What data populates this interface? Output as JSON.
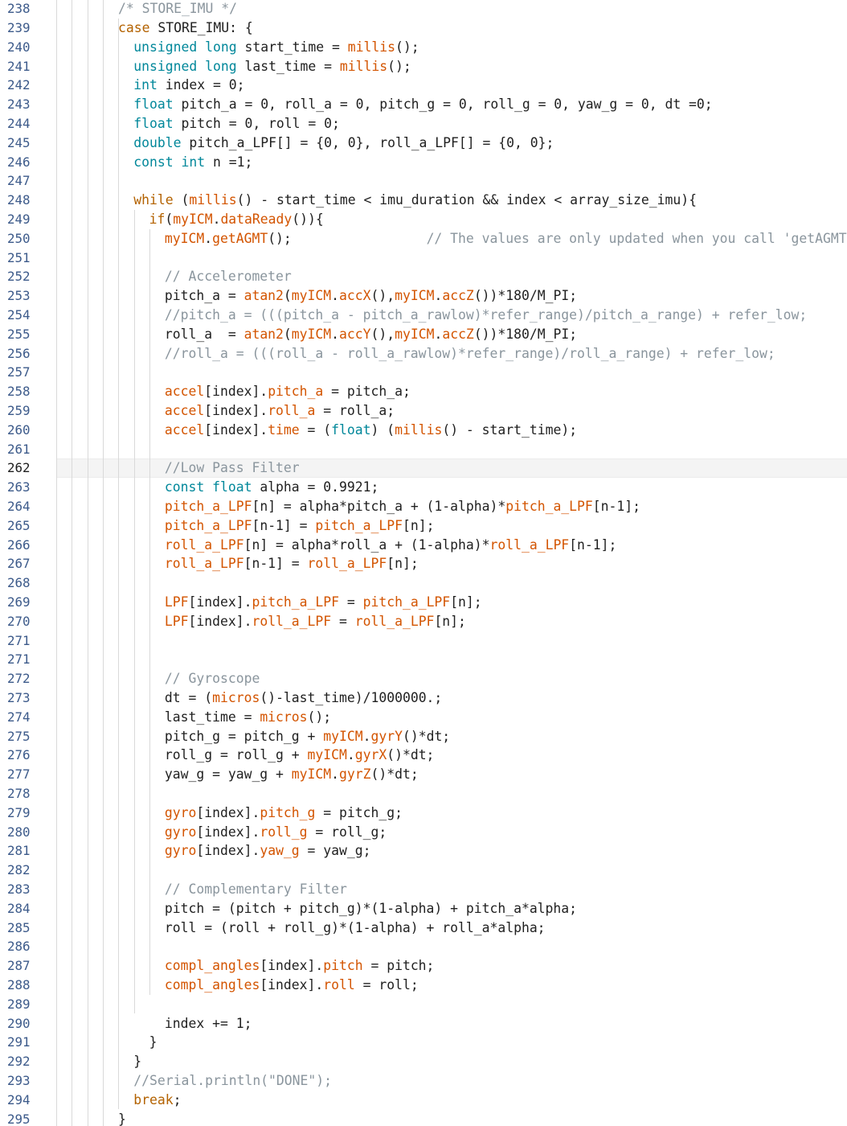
{
  "editor": {
    "current_line": "262",
    "lines": [
      {
        "n": "238",
        "i": 4,
        "t": [
          [
            "/* STORE_IMU */",
            "cm"
          ]
        ]
      },
      {
        "n": "239",
        "i": 4,
        "t": [
          [
            "case",
            "kw"
          ],
          [
            " STORE_IMU: {",
            ""
          ]
        ]
      },
      {
        "n": "240",
        "i": 5,
        "t": [
          [
            "unsigned",
            "ty"
          ],
          [
            " ",
            ""
          ],
          [
            "long",
            "ty"
          ],
          [
            " start_time = ",
            ""
          ],
          [
            "millis",
            "fn"
          ],
          [
            "();",
            ""
          ]
        ]
      },
      {
        "n": "241",
        "i": 5,
        "t": [
          [
            "unsigned",
            "ty"
          ],
          [
            " ",
            ""
          ],
          [
            "long",
            "ty"
          ],
          [
            " last_time = ",
            ""
          ],
          [
            "millis",
            "fn"
          ],
          [
            "();",
            ""
          ]
        ]
      },
      {
        "n": "242",
        "i": 5,
        "t": [
          [
            "int",
            "ty"
          ],
          [
            " index = 0;",
            ""
          ]
        ]
      },
      {
        "n": "243",
        "i": 5,
        "t": [
          [
            "float",
            "ty"
          ],
          [
            " pitch_a = 0, roll_a = 0, pitch_g = 0, roll_g = 0, yaw_g = 0, dt =0;",
            ""
          ]
        ]
      },
      {
        "n": "244",
        "i": 5,
        "t": [
          [
            "float",
            "ty"
          ],
          [
            " pitch = 0, roll = 0;",
            ""
          ]
        ]
      },
      {
        "n": "245",
        "i": 5,
        "t": [
          [
            "double",
            "ty"
          ],
          [
            " pitch_a_LPF[] = {0, 0}, roll_a_LPF[] = {0, 0};",
            ""
          ]
        ]
      },
      {
        "n": "246",
        "i": 5,
        "t": [
          [
            "const",
            "ty"
          ],
          [
            " ",
            ""
          ],
          [
            "int",
            "ty"
          ],
          [
            " n =1;",
            ""
          ]
        ]
      },
      {
        "n": "247",
        "i": 5,
        "t": []
      },
      {
        "n": "248",
        "i": 5,
        "t": [
          [
            "while",
            "kw"
          ],
          [
            " (",
            ""
          ],
          [
            "millis",
            "fn"
          ],
          [
            "() - start_time < imu_duration && index < array_size_imu){",
            ""
          ]
        ]
      },
      {
        "n": "249",
        "i": 6,
        "t": [
          [
            "if",
            "kw"
          ],
          [
            "(",
            ""
          ],
          [
            "myICM",
            "fn"
          ],
          [
            ".",
            ""
          ],
          [
            "dataReady",
            "fn"
          ],
          [
            "()){",
            ""
          ]
        ]
      },
      {
        "n": "250",
        "i": 7,
        "t": [
          [
            "myICM",
            "fn"
          ],
          [
            ".",
            ""
          ],
          [
            "getAGMT",
            "fn"
          ],
          [
            "();                 ",
            ""
          ],
          [
            "// The values are only updated when you call 'getAGMT'",
            "cm"
          ]
        ]
      },
      {
        "n": "251",
        "i": 7,
        "t": []
      },
      {
        "n": "252",
        "i": 7,
        "t": [
          [
            "// Accelerometer",
            "cm"
          ]
        ]
      },
      {
        "n": "253",
        "i": 7,
        "t": [
          [
            "pitch_a = ",
            ""
          ],
          [
            "atan2",
            "fn"
          ],
          [
            "(",
            ""
          ],
          [
            "myICM",
            "fn"
          ],
          [
            ".",
            ""
          ],
          [
            "accX",
            "fn"
          ],
          [
            "(),",
            ""
          ],
          [
            "myICM",
            "fn"
          ],
          [
            ".",
            ""
          ],
          [
            "accZ",
            "fn"
          ],
          [
            "())*180/M_PI;",
            ""
          ]
        ]
      },
      {
        "n": "254",
        "i": 7,
        "t": [
          [
            "//pitch_a = (((pitch_a - pitch_a_rawlow)*refer_range)/pitch_a_range) + refer_low;",
            "cm"
          ]
        ]
      },
      {
        "n": "255",
        "i": 7,
        "t": [
          [
            "roll_a  = ",
            ""
          ],
          [
            "atan2",
            "fn"
          ],
          [
            "(",
            ""
          ],
          [
            "myICM",
            "fn"
          ],
          [
            ".",
            ""
          ],
          [
            "accY",
            "fn"
          ],
          [
            "(),",
            ""
          ],
          [
            "myICM",
            "fn"
          ],
          [
            ".",
            ""
          ],
          [
            "accZ",
            "fn"
          ],
          [
            "())*180/M_PI;",
            ""
          ]
        ]
      },
      {
        "n": "256",
        "i": 7,
        "t": [
          [
            "//roll_a = (((roll_a - roll_a_rawlow)*refer_range)/roll_a_range) + refer_low;",
            "cm"
          ]
        ]
      },
      {
        "n": "257",
        "i": 7,
        "t": []
      },
      {
        "n": "258",
        "i": 7,
        "t": [
          [
            "accel",
            "fn"
          ],
          [
            "[index].",
            ""
          ],
          [
            "pitch_a",
            "fn"
          ],
          [
            " = pitch_a;",
            ""
          ]
        ]
      },
      {
        "n": "259",
        "i": 7,
        "t": [
          [
            "accel",
            "fn"
          ],
          [
            "[index].",
            ""
          ],
          [
            "roll_a",
            "fn"
          ],
          [
            " = roll_a;",
            ""
          ]
        ]
      },
      {
        "n": "260",
        "i": 7,
        "t": [
          [
            "accel",
            "fn"
          ],
          [
            "[index].",
            ""
          ],
          [
            "time",
            "fn"
          ],
          [
            " = (",
            ""
          ],
          [
            "float",
            "ty"
          ],
          [
            ") (",
            ""
          ],
          [
            "millis",
            "fn"
          ],
          [
            "() - start_time);",
            ""
          ]
        ]
      },
      {
        "n": "261",
        "i": 7,
        "t": []
      },
      {
        "n": "262",
        "i": 7,
        "t": [
          [
            "//Low Pass Filter",
            "cm"
          ]
        ]
      },
      {
        "n": "263",
        "i": 7,
        "t": [
          [
            "const",
            "ty"
          ],
          [
            " ",
            ""
          ],
          [
            "float",
            "ty"
          ],
          [
            " alpha = 0.9921;",
            ""
          ]
        ]
      },
      {
        "n": "264",
        "i": 7,
        "t": [
          [
            "pitch_a_LPF",
            "fn"
          ],
          [
            "[n] = alpha*pitch_a + (1-alpha)*",
            ""
          ],
          [
            "pitch_a_LPF",
            "fn"
          ],
          [
            "[n-1];",
            ""
          ]
        ]
      },
      {
        "n": "265",
        "i": 7,
        "t": [
          [
            "pitch_a_LPF",
            "fn"
          ],
          [
            "[n-1] = ",
            ""
          ],
          [
            "pitch_a_LPF",
            "fn"
          ],
          [
            "[n];",
            ""
          ]
        ]
      },
      {
        "n": "266",
        "i": 7,
        "t": [
          [
            "roll_a_LPF",
            "fn"
          ],
          [
            "[n] = alpha*roll_a + (1-alpha)*",
            ""
          ],
          [
            "roll_a_LPF",
            "fn"
          ],
          [
            "[n-1];",
            ""
          ]
        ]
      },
      {
        "n": "267",
        "i": 7,
        "t": [
          [
            "roll_a_LPF",
            "fn"
          ],
          [
            "[n-1] = ",
            ""
          ],
          [
            "roll_a_LPF",
            "fn"
          ],
          [
            "[n];",
            ""
          ]
        ]
      },
      {
        "n": "268",
        "i": 7,
        "t": []
      },
      {
        "n": "269",
        "i": 7,
        "t": [
          [
            "LPF",
            "fn"
          ],
          [
            "[index].",
            ""
          ],
          [
            "pitch_a_LPF",
            "fn"
          ],
          [
            " = ",
            ""
          ],
          [
            "pitch_a_LPF",
            "fn"
          ],
          [
            "[n];",
            ""
          ]
        ]
      },
      {
        "n": "270",
        "i": 7,
        "t": [
          [
            "LPF",
            "fn"
          ],
          [
            "[index].",
            ""
          ],
          [
            "roll_a_LPF",
            "fn"
          ],
          [
            " = ",
            ""
          ],
          [
            "roll_a_LPF",
            "fn"
          ],
          [
            "[n];",
            ""
          ]
        ]
      },
      {
        "n": "271",
        "i": 7,
        "t": []
      },
      {
        "n": "271",
        "i": 7,
        "t": []
      },
      {
        "n": "272",
        "i": 7,
        "t": [
          [
            "// Gyroscope",
            "cm"
          ]
        ]
      },
      {
        "n": "273",
        "i": 7,
        "t": [
          [
            "dt = (",
            ""
          ],
          [
            "micros",
            "fn"
          ],
          [
            "()-last_time)/1000000.;",
            ""
          ]
        ]
      },
      {
        "n": "274",
        "i": 7,
        "t": [
          [
            "last_time = ",
            ""
          ],
          [
            "micros",
            "fn"
          ],
          [
            "();",
            ""
          ]
        ]
      },
      {
        "n": "275",
        "i": 7,
        "t": [
          [
            "pitch_g = pitch_g + ",
            ""
          ],
          [
            "myICM",
            "fn"
          ],
          [
            ".",
            ""
          ],
          [
            "gyrY",
            "fn"
          ],
          [
            "()*dt;",
            ""
          ]
        ]
      },
      {
        "n": "276",
        "i": 7,
        "t": [
          [
            "roll_g = roll_g + ",
            ""
          ],
          [
            "myICM",
            "fn"
          ],
          [
            ".",
            ""
          ],
          [
            "gyrX",
            "fn"
          ],
          [
            "()*dt;",
            ""
          ]
        ]
      },
      {
        "n": "277",
        "i": 7,
        "t": [
          [
            "yaw_g = yaw_g + ",
            ""
          ],
          [
            "myICM",
            "fn"
          ],
          [
            ".",
            ""
          ],
          [
            "gyrZ",
            "fn"
          ],
          [
            "()*dt;",
            ""
          ]
        ]
      },
      {
        "n": "278",
        "i": 7,
        "t": []
      },
      {
        "n": "279",
        "i": 7,
        "t": [
          [
            "gyro",
            "fn"
          ],
          [
            "[index].",
            ""
          ],
          [
            "pitch_g",
            "fn"
          ],
          [
            " = pitch_g;",
            ""
          ]
        ]
      },
      {
        "n": "280",
        "i": 7,
        "t": [
          [
            "gyro",
            "fn"
          ],
          [
            "[index].",
            ""
          ],
          [
            "roll_g",
            "fn"
          ],
          [
            " = roll_g;",
            ""
          ]
        ]
      },
      {
        "n": "281",
        "i": 7,
        "t": [
          [
            "gyro",
            "fn"
          ],
          [
            "[index].",
            ""
          ],
          [
            "yaw_g",
            "fn"
          ],
          [
            " = yaw_g;",
            ""
          ]
        ]
      },
      {
        "n": "282",
        "i": 7,
        "t": []
      },
      {
        "n": "283",
        "i": 7,
        "t": [
          [
            "// Complementary Filter",
            "cm"
          ]
        ]
      },
      {
        "n": "284",
        "i": 7,
        "t": [
          [
            "pitch = (pitch + pitch_g)*(1-alpha) + pitch_a*alpha;",
            ""
          ]
        ]
      },
      {
        "n": "285",
        "i": 7,
        "t": [
          [
            "roll = (roll + roll_g)*(1-alpha) + roll_a*alpha;",
            ""
          ]
        ]
      },
      {
        "n": "286",
        "i": 7,
        "t": []
      },
      {
        "n": "287",
        "i": 7,
        "t": [
          [
            "compl_angles",
            "fn"
          ],
          [
            "[index].",
            ""
          ],
          [
            "pitch",
            "fn"
          ],
          [
            " = pitch;",
            ""
          ]
        ]
      },
      {
        "n": "288",
        "i": 7,
        "t": [
          [
            "compl_angles",
            "fn"
          ],
          [
            "[index].",
            ""
          ],
          [
            "roll",
            "fn"
          ],
          [
            " = roll;",
            ""
          ]
        ]
      },
      {
        "n": "289",
        "i": 7,
        "t": []
      },
      {
        "n": "290",
        "i": 7,
        "t": [
          [
            "index += 1;",
            ""
          ]
        ]
      },
      {
        "n": "291",
        "i": 6,
        "t": [
          [
            "}",
            ""
          ]
        ]
      },
      {
        "n": "292",
        "i": 5,
        "t": [
          [
            "}",
            ""
          ]
        ]
      },
      {
        "n": "293",
        "i": 5,
        "t": [
          [
            "//Serial.println(\"DONE\");",
            "cm"
          ]
        ]
      },
      {
        "n": "294",
        "i": 5,
        "t": [
          [
            "break",
            "kw"
          ],
          [
            ";",
            ""
          ]
        ]
      },
      {
        "n": "295",
        "i": 4,
        "t": [
          [
            "}",
            ""
          ]
        ]
      }
    ]
  }
}
